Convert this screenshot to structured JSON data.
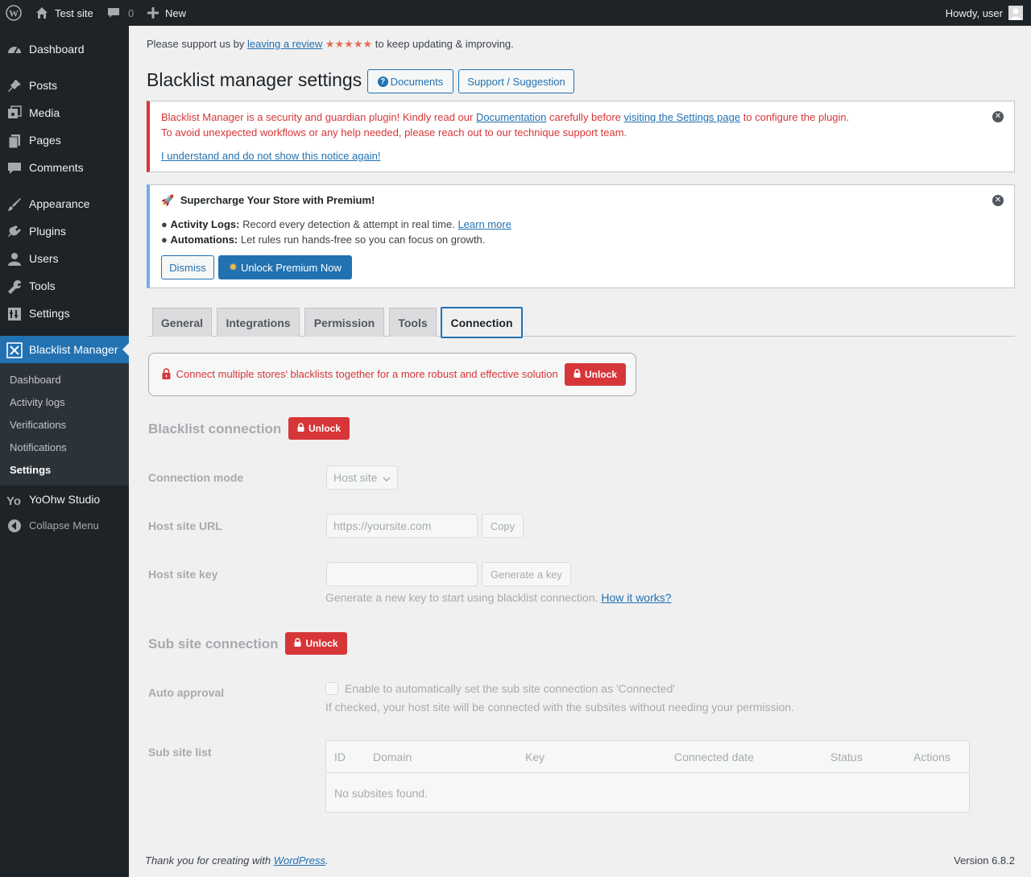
{
  "adminbar": {
    "site_name": "Test site",
    "comments_count": "0",
    "new_label": "New",
    "greeting": "Howdy, user"
  },
  "sidebar": {
    "items": [
      {
        "label": "Dashboard",
        "icon": "dashboard-icon"
      },
      {
        "label": "Posts",
        "icon": "pin-icon"
      },
      {
        "label": "Media",
        "icon": "media-icon"
      },
      {
        "label": "Pages",
        "icon": "pages-icon"
      },
      {
        "label": "Comments",
        "icon": "comments-icon"
      },
      {
        "label": "Appearance",
        "icon": "brush-icon"
      },
      {
        "label": "Plugins",
        "icon": "plugin-icon"
      },
      {
        "label": "Users",
        "icon": "user-icon"
      },
      {
        "label": "Tools",
        "icon": "wrench-icon"
      },
      {
        "label": "Settings",
        "icon": "settings-icon"
      },
      {
        "label": "Blacklist Manager",
        "icon": "blacklist-icon"
      },
      {
        "label": "YoOhw Studio",
        "icon": "yo-icon"
      },
      {
        "label": "Collapse Menu",
        "icon": "collapse-icon"
      }
    ],
    "submenu": [
      "Dashboard",
      "Activity logs",
      "Verifications",
      "Notifications",
      "Settings"
    ]
  },
  "review_bar": {
    "before": "Please support us by",
    "link": "leaving a review",
    "stars": "★★★★★",
    "after": "to keep updating & improving."
  },
  "page": {
    "title": "Blacklist manager settings",
    "documents_button": "Documents",
    "support_button": "Support / Suggestion"
  },
  "error_notice": {
    "line1_a": "Blacklist Manager is a security and guardian plugin! Kindly read our",
    "line1_link1": "Documentation",
    "line1_b": "carefully before",
    "line1_link2": "visiting the Settings page",
    "line1_c": "to configure the plugin.",
    "line2": "To avoid unexpected workflows or any help needed, please reach out to our technique support team.",
    "dismiss_link": "I understand and do not show this notice again!"
  },
  "premium_notice": {
    "title": "Supercharge Your Store with Premium!",
    "bullet1_label": "Activity Logs:",
    "bullet1_text": "Record every detection & attempt in real time.",
    "bullet1_link": "Learn more",
    "bullet2_label": "Automations:",
    "bullet2_text": "Let rules run hands-free so you can focus on growth.",
    "dismiss_button": "Dismiss",
    "unlock_button": "Unlock Premium Now"
  },
  "tabs": [
    "General",
    "Integrations",
    "Permission",
    "Tools",
    "Connection"
  ],
  "connection_banner": {
    "text": "Connect multiple stores' blacklists together for a more robust and effective solution",
    "button": "Unlock"
  },
  "blacklist_connection": {
    "title": "Blacklist connection",
    "unlock": "Unlock",
    "mode_label": "Connection mode",
    "mode_value": "Host site",
    "url_label": "Host site URL",
    "url_placeholder": "https://yoursite.com",
    "copy_button": "Copy",
    "key_label": "Host site key",
    "generate_button": "Generate a key",
    "key_desc": "Generate a new key to start using blacklist connection.",
    "key_desc_link": "How it works?"
  },
  "sub_site_connection": {
    "title": "Sub site connection",
    "unlock": "Unlock",
    "auto_label": "Auto approval",
    "auto_checkbox": "Enable to automatically set the sub site connection as 'Connected'",
    "auto_desc": "If checked, your host site will be connected with the subsites without needing your permission.",
    "list_label": "Sub site list",
    "columns": [
      "ID",
      "Domain",
      "Key",
      "Connected date",
      "Status",
      "Actions"
    ],
    "empty": "No subsites found."
  },
  "footer": {
    "thanks": "Thank you for creating with",
    "link": "WordPress",
    "period": ".",
    "version": "Version 6.8.2"
  },
  "colors": {
    "adminbar_bg": "#1d2327",
    "accent": "#2271b1",
    "danger": "#d63638",
    "star": "#e26f56"
  }
}
